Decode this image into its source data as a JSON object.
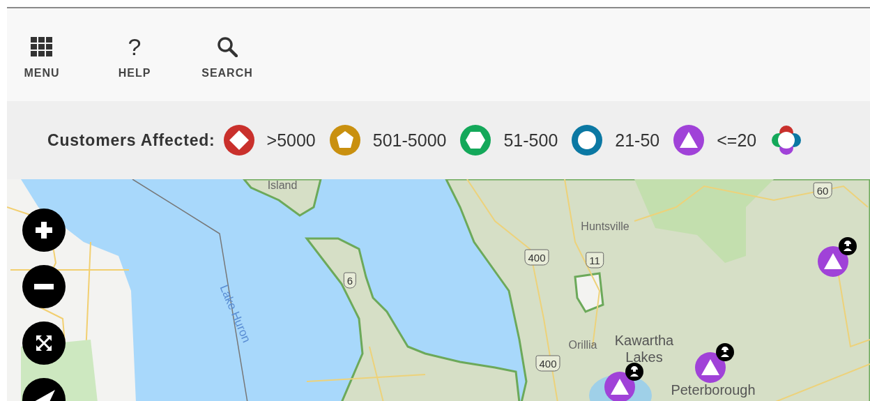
{
  "toolbar": {
    "items": [
      {
        "kind": "menu",
        "label": "MENU"
      },
      {
        "kind": "help",
        "icon_text": "?",
        "label": "HELP"
      },
      {
        "kind": "search",
        "label": "SEARCH"
      }
    ]
  },
  "legend": {
    "title": "Customers Affected:",
    "items": [
      {
        "kind": "diamond",
        "color": "#c9302c",
        "label": ">5000"
      },
      {
        "kind": "pentagon",
        "color": "#c9900f",
        "label": "501-5000"
      },
      {
        "kind": "hexagon",
        "color": "#14a85a",
        "label": "51-500"
      },
      {
        "kind": "ring",
        "color": "#0b78a3",
        "label": "21-50"
      },
      {
        "kind": "triangle",
        "color": "#a042d8",
        "label": "<=20"
      },
      {
        "kind": "multi"
      }
    ]
  },
  "map": {
    "labels": [
      {
        "kind": "place",
        "text": "Island"
      },
      {
        "kind": "water",
        "text": "Lake Huron"
      },
      {
        "kind": "place",
        "text": "Huntsville"
      },
      {
        "kind": "place",
        "text": "Orillia"
      },
      {
        "kind": "city",
        "text": "Kawartha Lakes"
      },
      {
        "kind": "city",
        "text": "Peterborough"
      },
      {
        "kind": "shield",
        "text": "60"
      },
      {
        "kind": "shield",
        "text": "400"
      },
      {
        "kind": "shield",
        "text": "11"
      },
      {
        "kind": "shield",
        "text": "6"
      },
      {
        "kind": "shield",
        "text": "400"
      }
    ],
    "outages": [
      {
        "kind": "triangle",
        "color": "#a042d8",
        "crew": true
      },
      {
        "kind": "triangle",
        "color": "#a042d8",
        "crew": true
      },
      {
        "kind": "triangle",
        "color": "#a042d8",
        "crew": true
      }
    ],
    "controls": [
      {
        "kind": "zoom-in"
      },
      {
        "kind": "zoom-out"
      },
      {
        "kind": "full-extent"
      },
      {
        "kind": "locate"
      }
    ]
  }
}
